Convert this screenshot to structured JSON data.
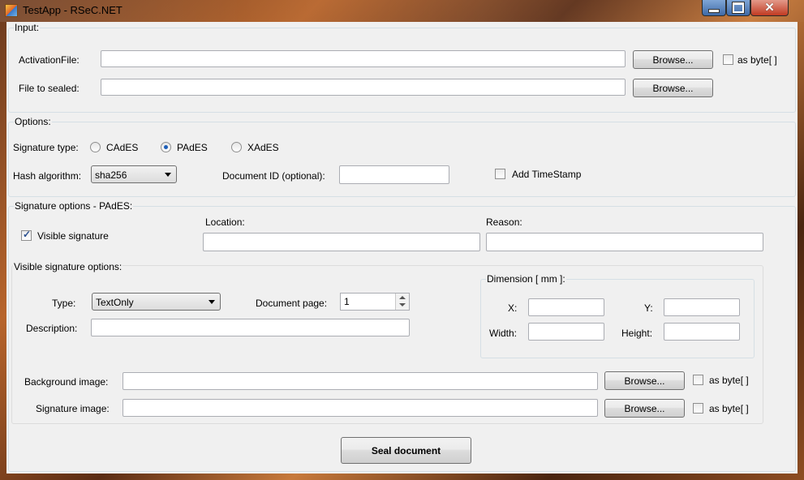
{
  "window": {
    "title": "TestApp - RSeC.NET"
  },
  "input_group": {
    "label": "Input:",
    "activation_label": "ActivationFile:",
    "activation_value": "",
    "activation_browse": "Browse...",
    "activation_as_byte": "as byte[ ]",
    "file_label": "File to sealed:",
    "file_value": "",
    "file_browse": "Browse..."
  },
  "options_group": {
    "label": "Options:",
    "signature_type_label": "Signature type:",
    "signature_types": [
      "CAdES",
      "PAdES",
      "XAdES"
    ],
    "signature_type_selected": "PAdES",
    "hash_label": "Hash algorithm:",
    "hash_value": "sha256",
    "document_id_label": "Document ID (optional):",
    "document_id_value": "",
    "add_timestamp_label": "Add TimeStamp",
    "add_timestamp_checked": false
  },
  "sig_options_group": {
    "label": "Signature options - PAdES:",
    "visible_signature_label": "Visible signature",
    "visible_signature_checked": true,
    "location_label": "Location:",
    "location_value": "",
    "reason_label": "Reason:",
    "reason_value": ""
  },
  "visible_options_group": {
    "label": "Visible signature options:",
    "type_label": "Type:",
    "type_value": "TextOnly",
    "document_page_label": "Document page:",
    "document_page_value": "1",
    "description_label": "Description:",
    "description_value": "",
    "dimension": {
      "label": "Dimension [ mm ]:",
      "x_label": "X:",
      "y_label": "Y:",
      "width_label": "Width:",
      "height_label": "Height:"
    },
    "background_label": "Background image:",
    "background_browse": "Browse...",
    "background_as_byte": "as byte[ ]",
    "signature_image_label": "Signature image:",
    "signature_image_browse": "Browse...",
    "signature_image_as_byte": "as byte[ ]"
  },
  "seal_button": "Seal document"
}
